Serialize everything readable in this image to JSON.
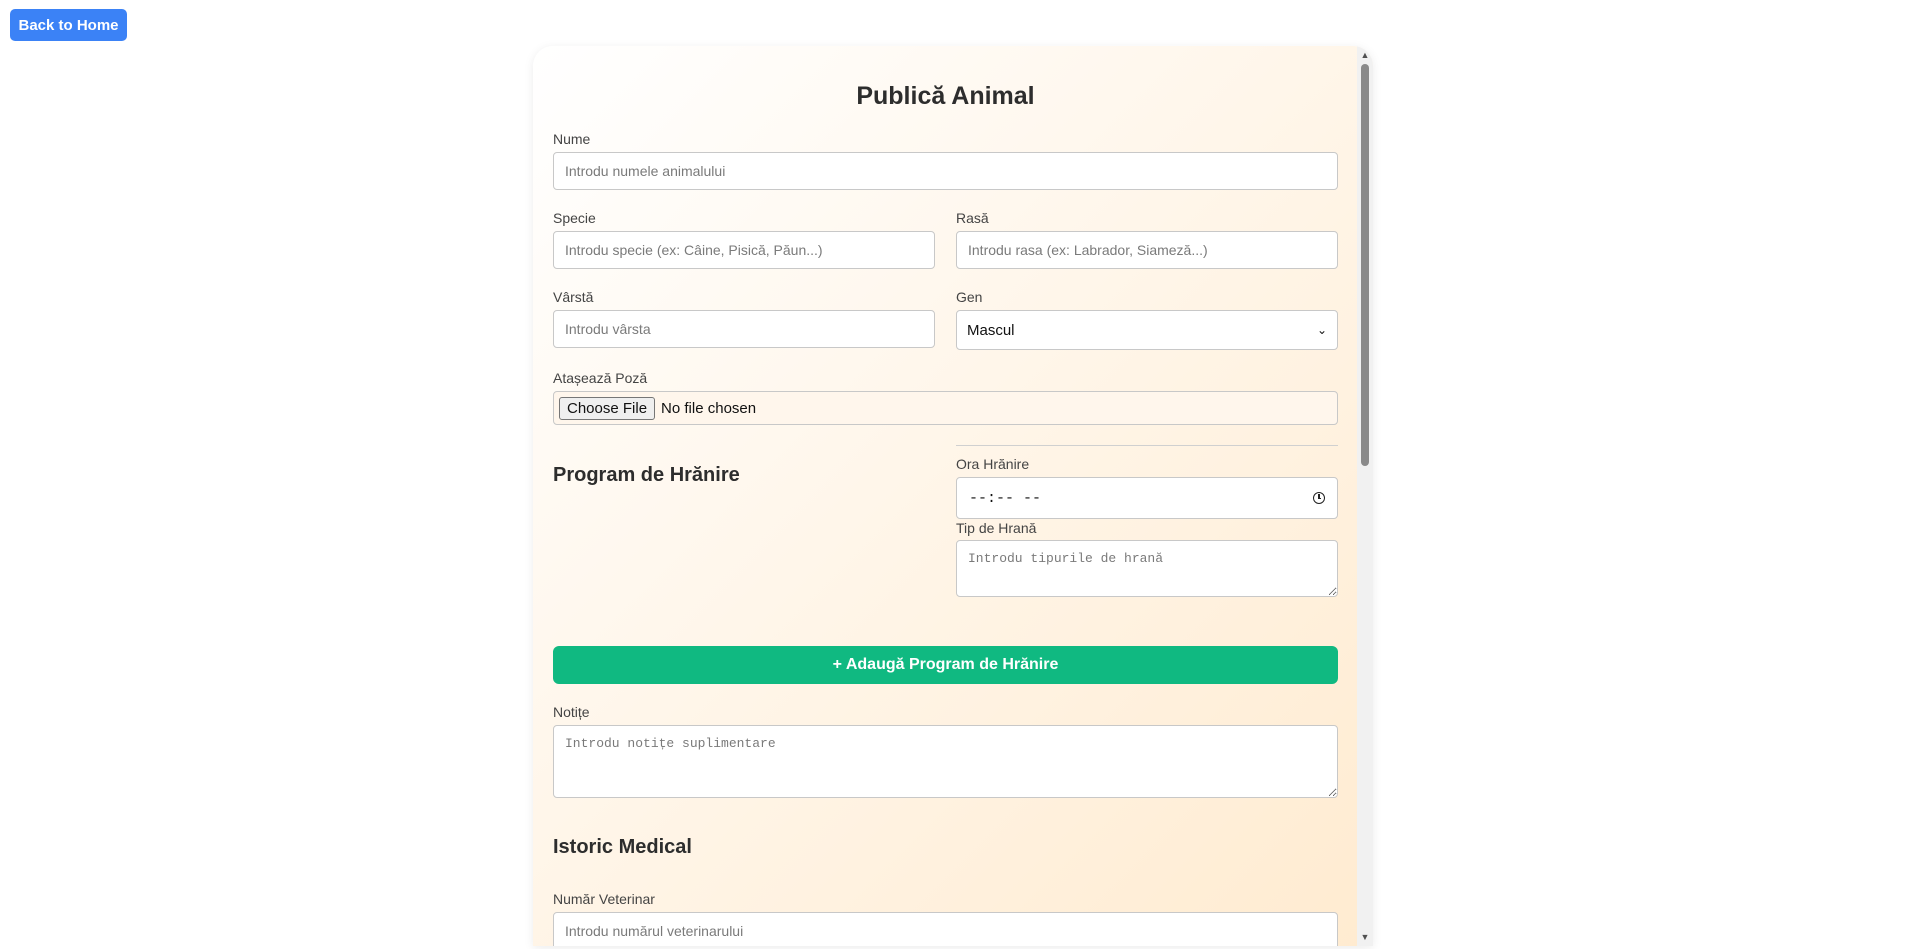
{
  "back_button": {
    "label": "Back to Home"
  },
  "form": {
    "title": "Publică Animal",
    "name": {
      "label": "Nume",
      "placeholder": "Introdu numele animalului",
      "value": ""
    },
    "species": {
      "label": "Specie",
      "placeholder": "Introdu specie (ex: Câine, Pisică, Păun...)",
      "value": ""
    },
    "breed": {
      "label": "Rasă",
      "placeholder": "Introdu rasa (ex: Labrador, Siameză...)",
      "value": ""
    },
    "age": {
      "label": "Vârstă",
      "placeholder": "Introdu vârsta",
      "value": ""
    },
    "gender": {
      "label": "Gen",
      "selected": "Mascul"
    },
    "photo": {
      "label": "Atașează Poză",
      "button_label": "Choose File",
      "status": "No file chosen"
    },
    "feeding": {
      "section_title": "Program de Hrănire",
      "time_label": "Ora Hrănire",
      "time_value": "--:-- --",
      "food_label": "Tip de Hrană",
      "food_placeholder": "Introdu tipurile de hrană",
      "add_button_label": "+ Adaugă Program de Hrănire"
    },
    "notes": {
      "label": "Notițe",
      "placeholder": "Introdu notițe suplimentare",
      "value": ""
    },
    "medical": {
      "section_title": "Istoric Medical",
      "vet_number_label": "Număr Veterinar",
      "vet_number_placeholder": "Introdu numărul veterinarului"
    }
  },
  "colors": {
    "primary_button": "#3b82f6",
    "success_button": "#10b981"
  },
  "icons": {
    "time": "clock-icon",
    "select": "chevron-down-icon",
    "scroll_up": "scroll-up-arrow-icon",
    "scroll_down": "scroll-down-arrow-icon"
  }
}
